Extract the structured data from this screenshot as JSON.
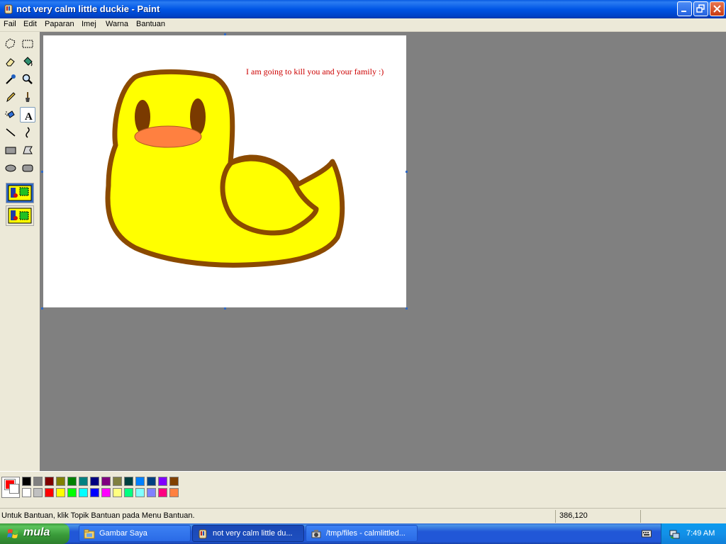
{
  "window": {
    "title": "not very calm little duckie - Paint",
    "app_icon": "paint-icon"
  },
  "menu": [
    "Fail",
    "Edit",
    "Paparan",
    "Imej",
    "Warna",
    "Bantuan"
  ],
  "toolbox": {
    "tools": [
      "free-form-select",
      "rectangle-select",
      "eraser",
      "fill-with-color",
      "pick-color",
      "magnifier",
      "pencil",
      "brush",
      "airbrush",
      "text",
      "line",
      "curve",
      "rectangle",
      "polygon",
      "ellipse",
      "rounded-rectangle"
    ],
    "active_tool": "text",
    "options": [
      "opaque-background",
      "transparent-background"
    ],
    "selected_option": "opaque-background"
  },
  "canvas": {
    "text": "I am going to kill you and your family :)",
    "drawing": "yellow-duck",
    "colors": {
      "body": "#ffff00",
      "outline": "#8b4a00",
      "eyes": "#7a3a00",
      "beak": "#ff8040",
      "text": "#cc0000"
    }
  },
  "palette": {
    "foreground": "#ff0000",
    "background": "#ffffff",
    "row1": [
      "#000000",
      "#808080",
      "#800000",
      "#808000",
      "#008000",
      "#008080",
      "#000080",
      "#800080",
      "#808040",
      "#004040",
      "#0080ff",
      "#004080",
      "#8000ff",
      "#804000"
    ],
    "row2": [
      "#ffffff",
      "#c0c0c0",
      "#ff0000",
      "#ffff00",
      "#00ff00",
      "#00ffff",
      "#0000ff",
      "#ff00ff",
      "#ffff80",
      "#00ff80",
      "#80ffff",
      "#8080ff",
      "#ff0080",
      "#ff8040"
    ]
  },
  "status": {
    "help_text": "Untuk Bantuan, klik Topik Bantuan pada Menu Bantuan.",
    "coordinates": "386,120"
  },
  "taskbar": {
    "start_label": "mula",
    "tasks": [
      {
        "label": "Gambar Saya",
        "icon": "folder-icon"
      },
      {
        "label": "not very calm little du...",
        "icon": "paint-icon",
        "active": true
      },
      {
        "label": "/tmp/files - calmlittled...",
        "icon": "file-browser-icon"
      }
    ],
    "clock": "7:49 AM"
  }
}
